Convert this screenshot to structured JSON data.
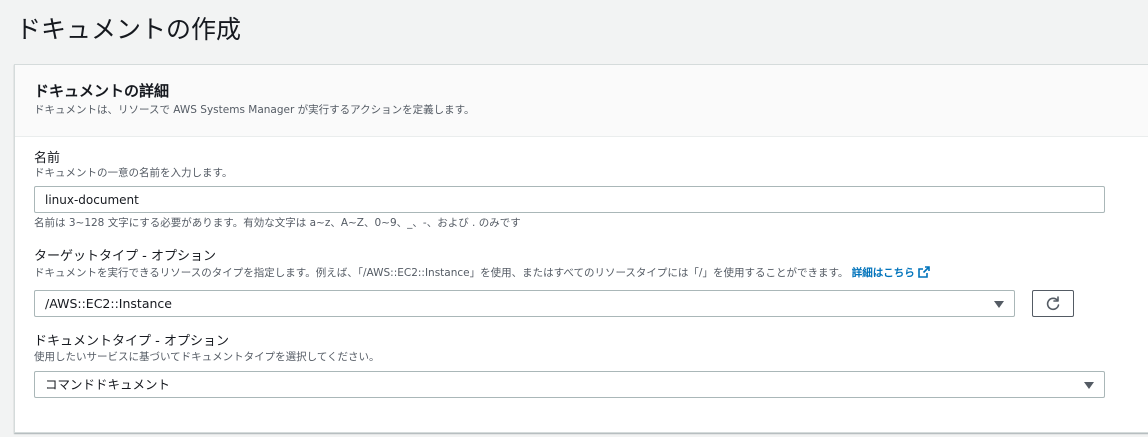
{
  "page": {
    "title": "ドキュメントの作成"
  },
  "details": {
    "title": "ドキュメントの詳細",
    "description": "ドキュメントは、リソースで AWS Systems Manager が実行するアクションを定義します。"
  },
  "name_field": {
    "label": "名前",
    "description": "ドキュメントの一意の名前を入力します。",
    "value": "linux-document",
    "constraint": "名前は 3~128 文字にする必要があります。有効な文字は a~z、A~Z、0~9、_、-、および . のみです"
  },
  "target_type": {
    "label": "ターゲットタイプ - オプション",
    "description": "ドキュメントを実行できるリソースのタイプを指定します。例えば、「/AWS::EC2::Instance」を使用、またはすべてのリソースタイプには「/」を使用することができます。",
    "link_label": "詳細はこちら",
    "selected": "/AWS::EC2::Instance"
  },
  "document_type": {
    "label": "ドキュメントタイプ - オプション",
    "description": "使用したいサービスに基づいてドキュメントタイプを選択してください。",
    "selected": "コマンドドキュメント"
  },
  "colors": {
    "link": "#0073bb",
    "background": "#f2f3f3",
    "panel_header": "#fafafa",
    "border": "#aab7b8"
  },
  "icons": {
    "dropdown": "caret-down-icon",
    "refresh": "refresh-icon",
    "external": "external-link-icon"
  }
}
